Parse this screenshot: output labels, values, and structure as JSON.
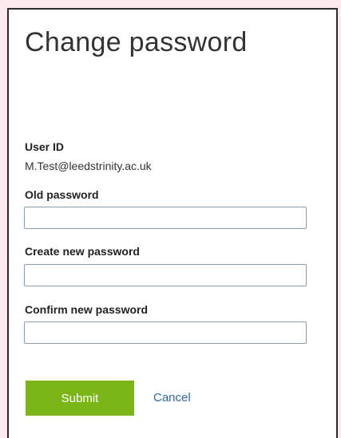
{
  "form": {
    "title": "Change password",
    "user_id_label": "User ID",
    "user_id_value": "M.Test@leedstrinity.ac.uk",
    "old_password_label": "Old password",
    "old_password_value": "",
    "new_password_label": "Create new password",
    "new_password_value": "",
    "confirm_password_label": "Confirm new password",
    "confirm_password_value": "",
    "submit_label": "Submit",
    "cancel_label": "Cancel"
  },
  "colors": {
    "page_background": "#fbe9ee",
    "submit_button": "#7cb518",
    "cancel_link": "#2b6cb0",
    "field_border": "#8a9bb3"
  }
}
